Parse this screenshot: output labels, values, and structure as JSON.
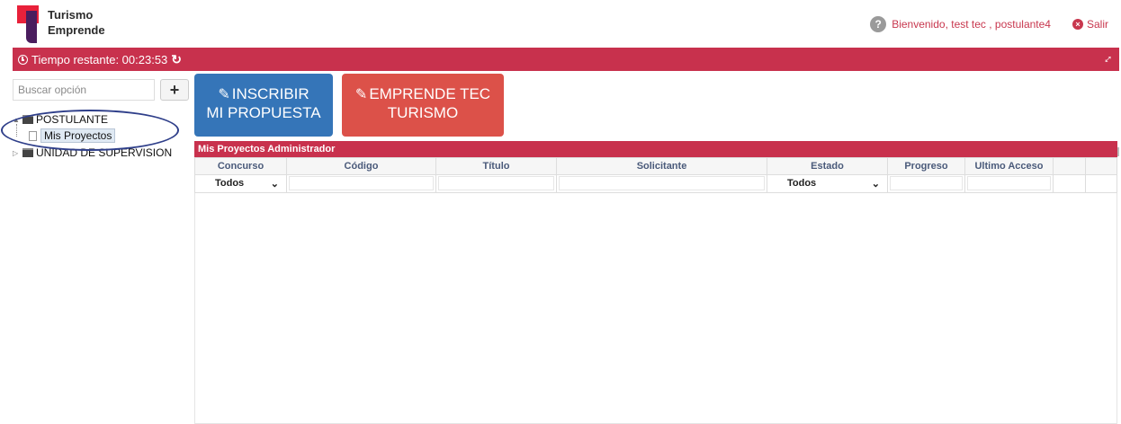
{
  "brand": {
    "line1": "Turismo",
    "line2": "Emprende"
  },
  "header": {
    "avatar_glyph": "?",
    "welcome": "Bienvenido, test tec , postulante4",
    "logout": "Salir"
  },
  "timer": {
    "label": "Tiempo restante: 00:23:53"
  },
  "sidebar": {
    "search_placeholder": "Buscar opción",
    "add_label": "+",
    "tree": {
      "node1": "POSTULANTE",
      "child1": "Mis Proyectos",
      "node2": "UNIDAD DE SUPERVISION"
    }
  },
  "actions": {
    "inscribir_line1": "INSCRIBIR",
    "inscribir_line2": "MI PROPUESTA",
    "emprende_line1": "EMPRENDE TEC",
    "emprende_line2": "TURISMO"
  },
  "grid": {
    "title": "Mis Proyectos Administrador",
    "columns": [
      "Concurso",
      "Código",
      "Título",
      "Solicitante",
      "Estado",
      "Progreso",
      "Ultimo Acceso",
      "",
      ""
    ],
    "filters": {
      "concurso": "Todos",
      "estado": "Todos"
    },
    "rows": []
  },
  "colors": {
    "accent": "#c8314d",
    "blue_button": "#3575b8",
    "red_button": "#dc5149",
    "link_pink": "#c8374e"
  }
}
